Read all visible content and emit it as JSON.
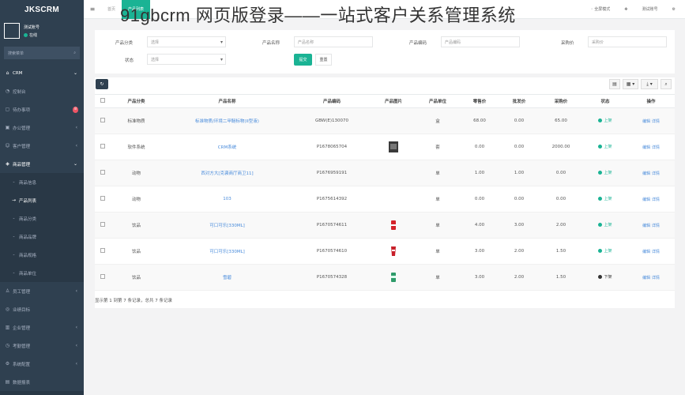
{
  "brand": "JKSCRM",
  "profile": {
    "name": "测试账号",
    "status": "在线"
  },
  "sidebar": {
    "search_placeholder": "搜索菜单",
    "items": [
      {
        "label": "CRM",
        "icon": "home-icon",
        "chevron": "⌄"
      },
      {
        "label": "控制台",
        "icon": "dashboard-icon"
      },
      {
        "label": "待办事项",
        "icon": "todo-icon",
        "badge": "8"
      },
      {
        "label": "办公管理",
        "icon": "office-icon",
        "chevron": "‹"
      },
      {
        "label": "客户管理",
        "icon": "users-icon",
        "chevron": "‹"
      },
      {
        "label": "商品管理",
        "icon": "goods-icon",
        "chevron": "⌄"
      },
      {
        "label": "商品信息",
        "icon": "dash-icon",
        "sub": true
      },
      {
        "label": "产品列表",
        "icon": "arrow-right-icon",
        "sub": true,
        "active": true
      },
      {
        "label": "商品分类",
        "icon": "dash-icon",
        "sub": true
      },
      {
        "label": "商品品牌",
        "icon": "dash-icon",
        "sub": true
      },
      {
        "label": "商品规格",
        "icon": "dash-icon",
        "sub": true
      },
      {
        "label": "商品单位",
        "icon": "dash-icon",
        "sub": true
      },
      {
        "label": "员工管理",
        "icon": "staff-icon",
        "chevron": "‹"
      },
      {
        "label": "业绩目标",
        "icon": "target-icon"
      },
      {
        "label": "企业管理",
        "icon": "company-icon",
        "chevron": "‹"
      },
      {
        "label": "考勤管理",
        "icon": "attendance-icon",
        "chevron": "‹"
      },
      {
        "label": "系统配置",
        "icon": "config-icon",
        "chevron": "‹"
      },
      {
        "label": "数据报表",
        "icon": "report-icon"
      },
      {
        "label": "常规管理",
        "icon": "settings-icon",
        "badge_new": "new"
      }
    ]
  },
  "topnav": {
    "menu_icon": "≡",
    "tabs": [
      {
        "label": "首页"
      },
      {
        "label": "产品列表",
        "active": true
      }
    ],
    "right": [
      "全屏模式",
      "测试账号"
    ],
    "right_icons": [
      "⚙",
      "✥"
    ]
  },
  "watermark": "91gbcrm 网页版登录——一站式客户关系管理系统",
  "filters": {
    "category_label": "产品分类",
    "category_value": "选择",
    "name_label": "产品名称",
    "name_placeholder": "产品名称",
    "code_label": "产品编码",
    "code_placeholder": "产品编码",
    "price_label": "采购价",
    "price_placeholder": "采购价",
    "status_label": "状态",
    "status_value": "选择",
    "search_button": "提交",
    "reset_button": "重置"
  },
  "toolbar": {
    "refresh": "↻",
    "list": "▤",
    "columns": "▦ ▾",
    "export": "⤓ ▾",
    "search": "⌕"
  },
  "table": {
    "headers": [
      "",
      "产品分类",
      "产品名称",
      "产品编码",
      "产品图片",
      "产品单位",
      "零售价",
      "批发价",
      "采购价",
      "状态",
      "操作"
    ],
    "rows": [
      {
        "category": "标准物质",
        "name": "标准物质/环境二甲醚标物(II型液)",
        "code": "GBW(E)130070",
        "image": "",
        "unit": "盒",
        "retail": "68.00",
        "wholesale": "0.00",
        "purchase": "65.00",
        "status": "上架",
        "status_color": "#1ab394",
        "op_edit": "编辑",
        "op_detail": "详情"
      },
      {
        "category": "软件系统",
        "name": "CRM系统",
        "code": "P1678065704",
        "image": "dark-photo",
        "unit": "套",
        "retail": "0.00",
        "wholesale": "0.00",
        "purchase": "2000.00",
        "status": "上架",
        "status_color": "#1ab394",
        "op_edit": "编辑",
        "op_detail": "详情"
      },
      {
        "category": "动物",
        "name": "西对方大[克袭商厅商卫11]",
        "code": "P1676959191",
        "image": "",
        "unit": "单",
        "retail": "1.00",
        "wholesale": "1.00",
        "purchase": "0.00",
        "status": "上架",
        "status_color": "#1ab394",
        "op_edit": "编辑",
        "op_detail": "详情"
      },
      {
        "category": "动物",
        "name": "103",
        "code": "P1675614392",
        "image": "",
        "unit": "单",
        "retail": "0.00",
        "wholesale": "0.00",
        "purchase": "0.00",
        "status": "上架",
        "status_color": "#1ab394",
        "op_edit": "编辑",
        "op_detail": "详情"
      },
      {
        "category": "饮品",
        "name": "可口可乐[330ML]",
        "code": "P1670574611",
        "image": "red-can",
        "unit": "单",
        "retail": "4.00",
        "wholesale": "3.00",
        "purchase": "2.00",
        "status": "上架",
        "status_color": "#1ab394",
        "op_edit": "编辑",
        "op_detail": "详情"
      },
      {
        "category": "饮品",
        "name": "可口可乐[330ML]",
        "code": "P1670574610",
        "image": "red-cup",
        "unit": "单",
        "retail": "3.00",
        "wholesale": "2.00",
        "purchase": "1.50",
        "status": "上架",
        "status_color": "#1ab394",
        "op_edit": "编辑",
        "op_detail": "详情"
      },
      {
        "category": "饮品",
        "name": "雪碧",
        "code": "P1670574328",
        "image": "green-can",
        "unit": "单",
        "retail": "3.00",
        "wholesale": "2.00",
        "purchase": "1.50",
        "status": "下架",
        "status_color": "#333333",
        "op_edit": "编辑",
        "op_detail": "详情"
      }
    ],
    "footer": "显示第 1 到第 7 条记录，总共 7 条记录"
  }
}
